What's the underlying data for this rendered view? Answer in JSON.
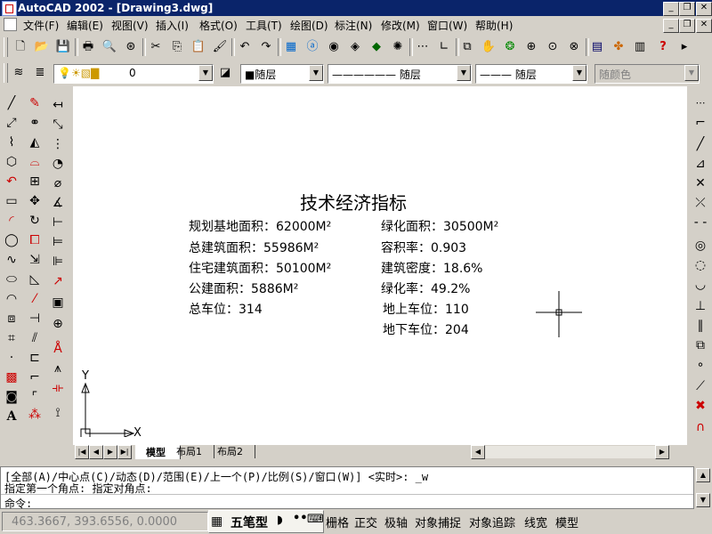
{
  "window": {
    "title": "AutoCAD 2002 - [Drawing3.dwg]"
  },
  "menus": [
    "文件(F)",
    "编辑(E)",
    "视图(V)",
    "插入(I)",
    "格式(O)",
    "工具(T)",
    "绘图(D)",
    "标注(N)",
    "修改(M)",
    "窗口(W)",
    "帮助(H)"
  ],
  "properties_bar": {
    "layer_value": "0",
    "color_value": "■随层",
    "linetype_value": "——————  随层",
    "lineweight_value": "———  随层",
    "plotstyle_value": "随颜色"
  },
  "drawing": {
    "title": "技术经济指标",
    "left_items": [
      "规划基地面积：62000M²",
      "总建筑面积：55986M²",
      "住宅建筑面积：50100M²",
      "公建面积：5886M²",
      "总车位：314"
    ],
    "right_items": [
      "绿化面积：30500M²",
      "容积率：0.903",
      "建筑密度：18.6%",
      "绿化率：49.2%",
      "地上车位：110",
      "地下车位：204"
    ],
    "ucs_y": "Y",
    "ucs_x": "X"
  },
  "tabs": [
    "模型",
    "布局1",
    "布局2"
  ],
  "command": {
    "line1": "[全部(A)/中心点(C)/动态(D)/范围(E)/上一个(P)/比例(S)/窗口(W)] <实时>: _w",
    "line2": "指定第一个角点: 指定对角点:",
    "prompt": "命令:"
  },
  "status": {
    "coords": "463.3667, 393.6556, 0.0000",
    "ime": "五笔型",
    "toggles": [
      "栅格",
      "正交",
      "极轴",
      "对象捕捉",
      "对象追踪",
      "线宽",
      "模型"
    ]
  }
}
